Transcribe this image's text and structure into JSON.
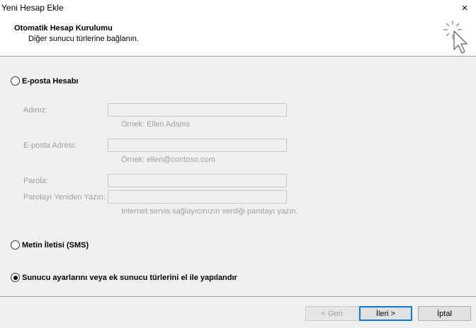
{
  "window": {
    "title": "Yeni Hesap Ekle",
    "close_icon": "×"
  },
  "header": {
    "title": "Otomatik Hesap Kurulumu",
    "subtitle": "Diğer sunucu türlerine bağlanın.",
    "icon": "cursor-sparkle-icon"
  },
  "options": {
    "email_account": {
      "label": "E-posta Hesabı",
      "selected": false
    },
    "sms": {
      "label": "Metin İletisi (SMS)",
      "selected": false
    },
    "manual": {
      "label": "Sunucu ayarlarını veya ek sunucu türlerini el ile yapılandır",
      "selected": true
    }
  },
  "form": {
    "name_label": "Adınız:",
    "name_value": "",
    "name_hint": "Örnek: Ellen Adams",
    "email_label": "E-posta Adresi:",
    "email_value": "",
    "email_hint": "Örnek: ellen@contoso.com",
    "password_label": "Parola:",
    "password_value": "",
    "password_confirm_label": "Parolayı Yeniden Yazın:",
    "password_confirm_value": "",
    "password_hint": "Internet servis sağlayıcınızın verdiği parolayı yazın."
  },
  "buttons": {
    "back": "< Geri",
    "next": "İleri >",
    "cancel": "İptal"
  },
  "colors": {
    "disabled_text": "#a0a0a0",
    "default_button_border": "#0078d7",
    "background": "#f0f0f0"
  }
}
